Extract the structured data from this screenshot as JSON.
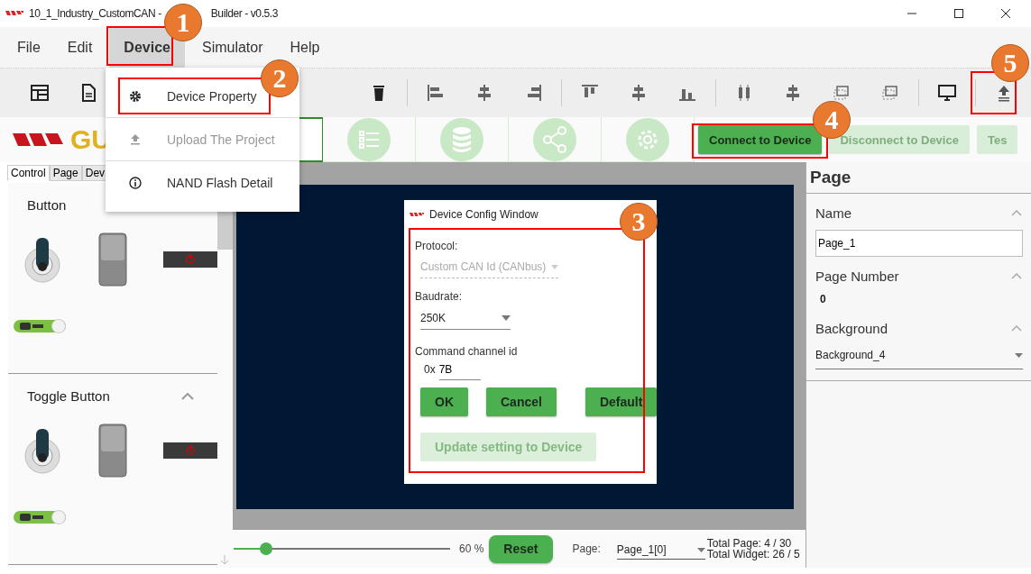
{
  "window": {
    "title_start": "10_1_Industry_CustomCAN - ",
    "title_end": "Builder - v0.5.3"
  },
  "menu": [
    {
      "label": "File",
      "selected": false
    },
    {
      "label": "Edit",
      "selected": false
    },
    {
      "label": "Device",
      "selected": true
    },
    {
      "label": "Simulator",
      "selected": false
    },
    {
      "label": "Help",
      "selected": false
    }
  ],
  "device_menu": [
    {
      "kind": "gear",
      "label": "Device Property",
      "disabled": false
    },
    {
      "kind": "upload",
      "label": "Upload The Project",
      "disabled": true
    },
    {
      "kind": "info",
      "label": "NAND Flash Detail",
      "disabled": false
    }
  ],
  "logo": {
    "text": "GU"
  },
  "device_buttons": [
    {
      "label": "Connect to Device",
      "disabled": false
    },
    {
      "label": "Disconnect to Device",
      "disabled": true
    },
    {
      "label": "Tes",
      "disabled": true
    }
  ],
  "left_panel": {
    "tabs": [
      {
        "label": "Control",
        "selected": true
      },
      {
        "label": "Page",
        "selected": false
      },
      {
        "label": "Dev",
        "selected": false
      }
    ],
    "sections": [
      {
        "title": "Button"
      },
      {
        "title": "Toggle Button"
      }
    ]
  },
  "dialog": {
    "title": "Device Config Window",
    "protocol": {
      "label": "Protocol:",
      "value": "Custom CAN Id (CANbus)",
      "disabled": true
    },
    "baudrate": {
      "label": "Baudrate:",
      "value": "250K"
    },
    "channel": {
      "label": "Command channel id",
      "prefix": "0x",
      "value": "7B"
    },
    "buttons": [
      {
        "label": "OK",
        "disabled": false
      },
      {
        "label": "Cancel",
        "disabled": false
      },
      {
        "label": "Default",
        "disabled": false
      },
      {
        "label": "Update setting to Device",
        "disabled": true
      }
    ]
  },
  "zoom": {
    "level": 0.15,
    "reading": "60 %",
    "reset": "Reset"
  },
  "page_select": {
    "label": "Page:",
    "value": "Page_1[0]"
  },
  "totals": [
    "Total Page: 4 / 30",
    "Total Widget: 26 / 5"
  ],
  "properties": {
    "title": "Page",
    "sections": [
      {
        "kind": "field",
        "title": "Name",
        "value": "Page_1"
      },
      {
        "kind": "text",
        "title": "Page Number",
        "value": "0"
      },
      {
        "kind": "select",
        "title": "Background",
        "value": "Background_4"
      }
    ]
  },
  "annotations": [
    "1",
    "2",
    "3",
    "4",
    "5"
  ]
}
